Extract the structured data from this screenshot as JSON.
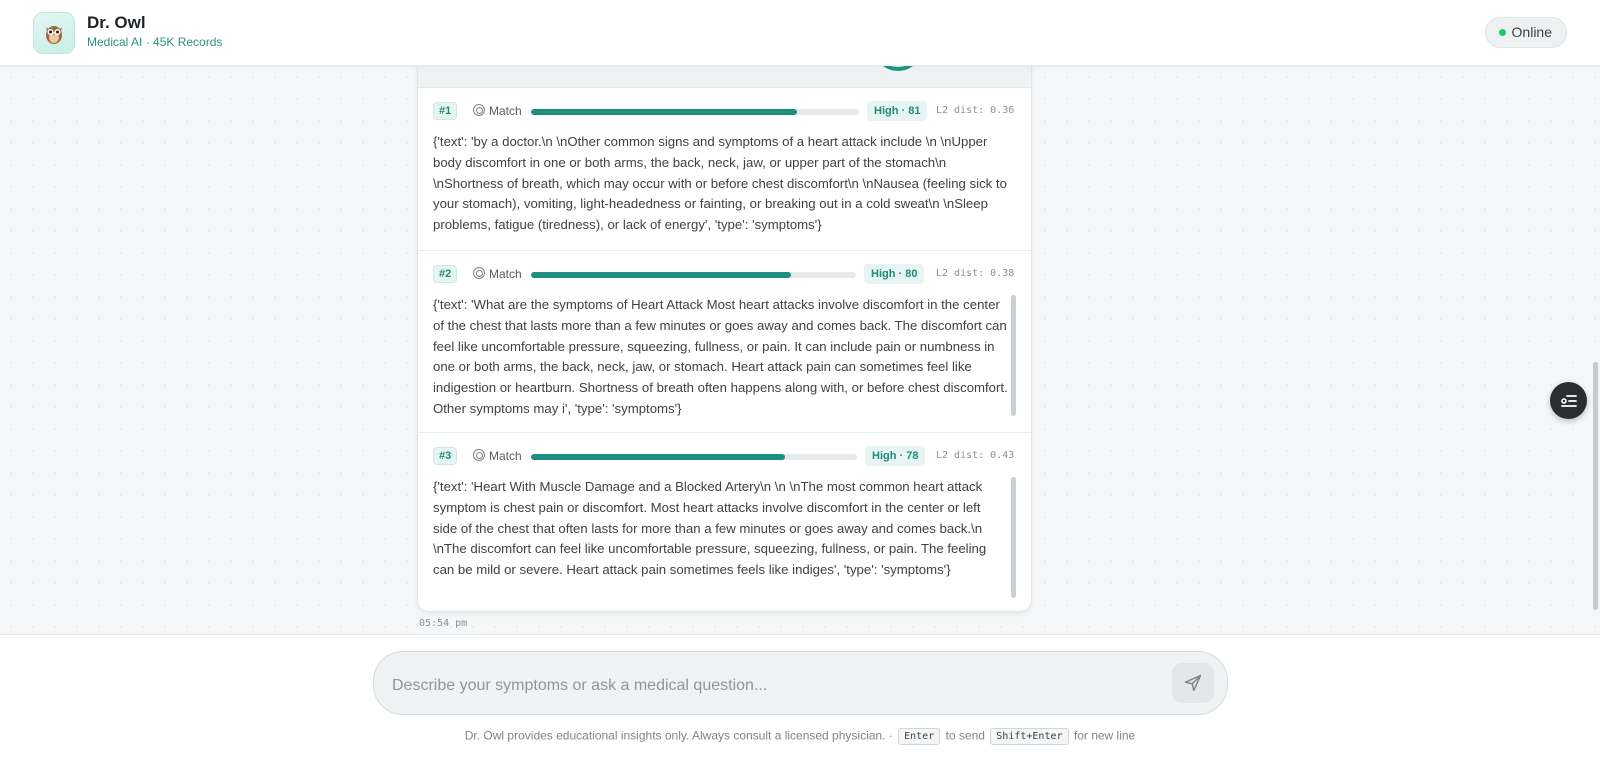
{
  "header": {
    "title": "Dr. Owl",
    "subtitle": "Medical AI · 45K Records",
    "status": "Online",
    "logo_icon": "owl-icon"
  },
  "results": [
    {
      "rank": "#1",
      "match_label": "Match",
      "score_label": "High · 81",
      "score": 0.81,
      "distance": "L2 dist: 0.36",
      "text": "{'text': 'by a doctor.\\n \\nOther common signs and symptoms of a heart attack include \\n \\nUpper body discomfort in one or both arms, the back, neck, jaw, or upper part of the stomach\\n \\nShortness of breath, which may occur with or before chest discomfort\\n \\nNausea (feeling sick to your stomach), vomiting, light-headedness or fainting, or breaking out in a cold sweat\\n \\nSleep problems, fatigue (tiredness), or lack of energy', 'type': 'symptoms'}"
    },
    {
      "rank": "#2",
      "match_label": "Match",
      "score_label": "High · 80",
      "score": 0.8,
      "distance": "L2 dist: 0.38",
      "text": "{'text': 'What are the symptoms of Heart Attack Most heart attacks involve discomfort in the center of the chest that lasts more than a few minutes or goes away and comes back. The discomfort can feel like uncomfortable pressure, squeezing, fullness, or pain. It can include pain or numbness in one or both arms, the back, neck, jaw, or stomach. Heart attack pain can sometimes feel like indigestion or heartburn. Shortness of breath often happens along with, or before chest discomfort. Other symptoms may i', 'type': 'symptoms'}"
    },
    {
      "rank": "#3",
      "match_label": "Match",
      "score_label": "High · 78",
      "score": 0.78,
      "distance": "L2 dist: 0.43",
      "text": "{'text': 'Heart With Muscle Damage and a Blocked Artery\\n \\n \\nThe most common heart attack symptom is chest pain or discomfort. Most heart attacks involve discomfort in the center or left side of the chest that often lasts for more than a few minutes or goes away and comes back.\\n \\nThe discomfort can feel like uncomfortable pressure, squeezing, fullness, or pain. The feeling can be mild or severe. Heart attack pain sometimes feels like indiges', 'type': 'symptoms'}"
    }
  ],
  "timestamp": "05:54 pm",
  "composer": {
    "placeholder": "Describe your symptoms or ask a medical question...",
    "send_icon": "send-icon"
  },
  "footer": {
    "disclaimer": "Dr. Owl provides educational insights only. Always consult a licensed physician. ·",
    "enter_key": "Enter",
    "enter_text": "to send",
    "shift_key": "Shift+Enter",
    "shift_text": "for new line"
  },
  "colors": {
    "accent": "#1e8f81",
    "online": "#22c55e"
  }
}
